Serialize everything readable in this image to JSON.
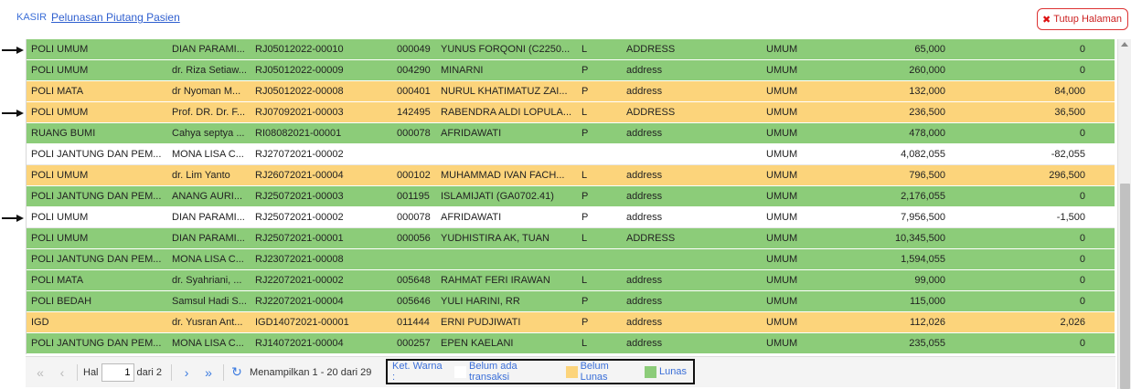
{
  "breadcrumb": {
    "root": "KASIR",
    "current": "Pelunasan Piutang Pasien"
  },
  "close_button": {
    "label": "Tutup Halaman",
    "icon": "close-x-icon"
  },
  "colors": {
    "lunas": "#8ccc79",
    "belum_lunas": "#fcd47b",
    "belum_ada_transaksi": "#ffffff"
  },
  "rows": [
    {
      "status": "green",
      "arrow": true,
      "poli": "POLI UMUM",
      "dokter": "DIAN PARAMI...",
      "reg": "RJ05012022-00010",
      "rm": "000049",
      "nama": "YUNUS FORQONI (C2250...",
      "jk": "L",
      "alamat": "ADDRESS",
      "jenis": "UMUM",
      "total": "65,000",
      "sisa": "0"
    },
    {
      "status": "green",
      "arrow": false,
      "poli": "POLI UMUM",
      "dokter": "dr. Riza Setiaw...",
      "reg": "RJ05012022-00009",
      "rm": "004290",
      "nama": "MINARNI",
      "jk": "P",
      "alamat": "address",
      "jenis": "UMUM",
      "total": "260,000",
      "sisa": "0"
    },
    {
      "status": "yellow",
      "arrow": false,
      "poli": "POLI MATA",
      "dokter": "dr Nyoman M...",
      "reg": "RJ05012022-00008",
      "rm": "000401",
      "nama": "NURUL KHATIMATUZ ZAI...",
      "jk": "P",
      "alamat": "address",
      "jenis": "UMUM",
      "total": "132,000",
      "sisa": "84,000"
    },
    {
      "status": "yellow",
      "arrow": true,
      "poli": "POLI UMUM",
      "dokter": "Prof. DR. Dr. F...",
      "reg": "RJ07092021-00003",
      "rm": "142495",
      "nama": "RABENDRA ALDI LOPULA...",
      "jk": "L",
      "alamat": "ADDRESS",
      "jenis": "UMUM",
      "total": "236,500",
      "sisa": "36,500"
    },
    {
      "status": "green",
      "arrow": false,
      "poli": "RUANG BUMI",
      "dokter": "Cahya septya ...",
      "reg": "RI08082021-00001",
      "rm": "000078",
      "nama": "AFRIDAWATI",
      "jk": "P",
      "alamat": "address",
      "jenis": "UMUM",
      "total": "478,000",
      "sisa": "0"
    },
    {
      "status": "white",
      "arrow": false,
      "poli": "POLI JANTUNG DAN PEM...",
      "dokter": "MONA LISA C...",
      "reg": "RJ27072021-00002",
      "rm": "",
      "nama": "",
      "jk": "",
      "alamat": "",
      "jenis": "UMUM",
      "total": "4,082,055",
      "sisa": "-82,055"
    },
    {
      "status": "yellow",
      "arrow": false,
      "poli": "POLI UMUM",
      "dokter": "dr. Lim Yanto",
      "reg": "RJ26072021-00004",
      "rm": "000102",
      "nama": "MUHAMMAD IVAN FACH...",
      "jk": "L",
      "alamat": "address",
      "jenis": "UMUM",
      "total": "796,500",
      "sisa": "296,500"
    },
    {
      "status": "green",
      "arrow": false,
      "poli": "POLI JANTUNG DAN PEM...",
      "dokter": "ANANG AURI...",
      "reg": "RJ25072021-00003",
      "rm": "001195",
      "nama": "ISLAMIJATI (GA0702.41)",
      "jk": "P",
      "alamat": "address",
      "jenis": "UMUM",
      "total": "2,176,055",
      "sisa": "0"
    },
    {
      "status": "white",
      "arrow": true,
      "poli": "POLI UMUM",
      "dokter": "DIAN PARAMI...",
      "reg": "RJ25072021-00002",
      "rm": "000078",
      "nama": "AFRIDAWATI",
      "jk": "P",
      "alamat": "address",
      "jenis": "UMUM",
      "total": "7,956,500",
      "sisa": "-1,500"
    },
    {
      "status": "green",
      "arrow": false,
      "poli": "POLI UMUM",
      "dokter": "DIAN PARAMI...",
      "reg": "RJ25072021-00001",
      "rm": "000056",
      "nama": "YUDHISTIRA AK, TUAN",
      "jk": "L",
      "alamat": "ADDRESS",
      "jenis": "UMUM",
      "total": "10,345,500",
      "sisa": "0"
    },
    {
      "status": "green",
      "arrow": false,
      "poli": "POLI JANTUNG DAN PEM...",
      "dokter": "MONA LISA C...",
      "reg": "RJ23072021-00008",
      "rm": "",
      "nama": "",
      "jk": "",
      "alamat": "",
      "jenis": "UMUM",
      "total": "1,594,055",
      "sisa": "0"
    },
    {
      "status": "green",
      "arrow": false,
      "poli": "POLI MATA",
      "dokter": "dr. Syahriani, ...",
      "reg": "RJ22072021-00002",
      "rm": "005648",
      "nama": "RAHMAT FERI IRAWAN",
      "jk": "L",
      "alamat": "address",
      "jenis": "UMUM",
      "total": "99,000",
      "sisa": "0"
    },
    {
      "status": "green",
      "arrow": false,
      "poli": "POLI BEDAH",
      "dokter": "Samsul Hadi S...",
      "reg": "RJ22072021-00004",
      "rm": "005646",
      "nama": "YULI HARINI, RR",
      "jk": "P",
      "alamat": "address",
      "jenis": "UMUM",
      "total": "115,000",
      "sisa": "0"
    },
    {
      "status": "yellow",
      "arrow": false,
      "poli": "IGD",
      "dokter": "dr. Yusran Ant...",
      "reg": "IGD14072021-00001",
      "rm": "011444",
      "nama": "ERNI PUDJIWATI",
      "jk": "P",
      "alamat": "address",
      "jenis": "UMUM",
      "total": "112,026",
      "sisa": "2,026"
    },
    {
      "status": "green",
      "arrow": false,
      "poli": "POLI JANTUNG DAN PEM...",
      "dokter": "MONA LISA C...",
      "reg": "RJ14072021-00004",
      "rm": "000257",
      "nama": "EPEN KAELANI",
      "jk": "L",
      "alamat": "address",
      "jenis": "UMUM",
      "total": "235,055",
      "sisa": "0"
    }
  ],
  "pager": {
    "hal_label": "Hal",
    "page_value": "1",
    "dari_label": "dari 2",
    "showing_label": "Menampilkan 1 - 20 dari 29"
  },
  "legend": {
    "title": "Ket. Warna :",
    "items": [
      {
        "label": "Belum ada transaksi",
        "color": "#ffffff"
      },
      {
        "label": "Belum Lunas",
        "color": "#fcd47b"
      },
      {
        "label": "Lunas",
        "color": "#8ccc79"
      }
    ]
  }
}
